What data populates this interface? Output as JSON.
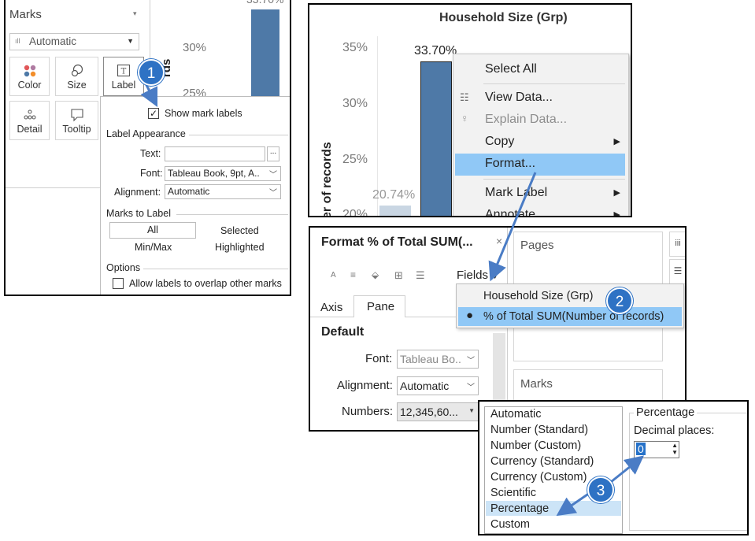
{
  "marks_panel": {
    "title": "Marks",
    "mark_type": "Automatic",
    "buttons": {
      "color": "Color",
      "size": "Size",
      "label": "Label",
      "detail": "Detail",
      "tooltip": "Tooltip"
    },
    "axis_ticks": [
      "30%",
      "25%"
    ],
    "axis_label_fragment": "rds"
  },
  "label_popup": {
    "show_mark_labels": "Show mark labels",
    "label_appearance": "Label Appearance",
    "text_label": "Text:",
    "text_value": "",
    "more_button": "...",
    "font_label": "Font:",
    "font_value": "Tableau Book, 9pt, A..",
    "alignment_label": "Alignment:",
    "alignment_value": "Automatic",
    "marks_to_label": "Marks to Label",
    "options_marks": [
      "All",
      "Selected",
      "Min/Max",
      "Highlighted"
    ],
    "options": "Options",
    "allow_overlap": "Allow labels to overlap other marks"
  },
  "chart_panel": {
    "title": "Household Size (Grp)",
    "ticks": [
      "35%",
      "30%",
      "25%",
      "20%"
    ],
    "ylabel": "er of records",
    "bar_labels": [
      "33.70%",
      "20.74%"
    ]
  },
  "chart_data": {
    "type": "bar",
    "title": "Household Size (Grp)",
    "ylabel": "er of records",
    "values": [
      33.7,
      20.74
    ],
    "ylim": [
      19.5,
      36
    ]
  },
  "context_menu": {
    "items": [
      {
        "label": "Select All",
        "arrow": false,
        "disabled": false
      },
      {
        "label": "View Data...",
        "arrow": false,
        "disabled": false
      },
      {
        "label": "Explain Data...",
        "arrow": false,
        "disabled": true
      },
      {
        "label": "Copy",
        "arrow": true,
        "disabled": false
      },
      {
        "label": "Format...",
        "arrow": false,
        "disabled": false
      },
      {
        "label": "Mark Label",
        "arrow": true,
        "disabled": false
      },
      {
        "label": "Annotate",
        "arrow": true,
        "disabled": false
      }
    ],
    "highlight_color": "#90c8f6"
  },
  "format_panel": {
    "title": "Format % of Total SUM(...",
    "close": "×",
    "fields_button": "Fields",
    "tabs": [
      "Axis",
      "Pane"
    ],
    "section": "Default",
    "font_label": "Font:",
    "font_value": "Tableau Bo..",
    "alignment_label": "Alignment:",
    "alignment_value": "Automatic",
    "numbers_label": "Numbers:",
    "numbers_value": "12,345,60...",
    "pages": "Pages",
    "marks": "Marks"
  },
  "fields_dropdown": {
    "items": [
      "Household Size (Grp)",
      "% of Total SUM(Number of records)"
    ],
    "selected_index": 1
  },
  "number_formats": {
    "items": [
      "Automatic",
      "Number (Standard)",
      "Number (Custom)",
      "Currency (Standard)",
      "Currency (Custom)",
      "Scientific",
      "Percentage",
      "Custom"
    ],
    "selected": "Percentage",
    "group_title": "Percentage",
    "decimal_label": "Decimal places:",
    "decimal_value": "0"
  },
  "steps": [
    "1",
    "2",
    "3"
  ],
  "colors": {
    "bar": "#4e79a7",
    "bar_light": "#c9d6e3",
    "highlight": "#90c8f6",
    "badge": "#2e72c4",
    "arrow": "#4a7cc5"
  }
}
